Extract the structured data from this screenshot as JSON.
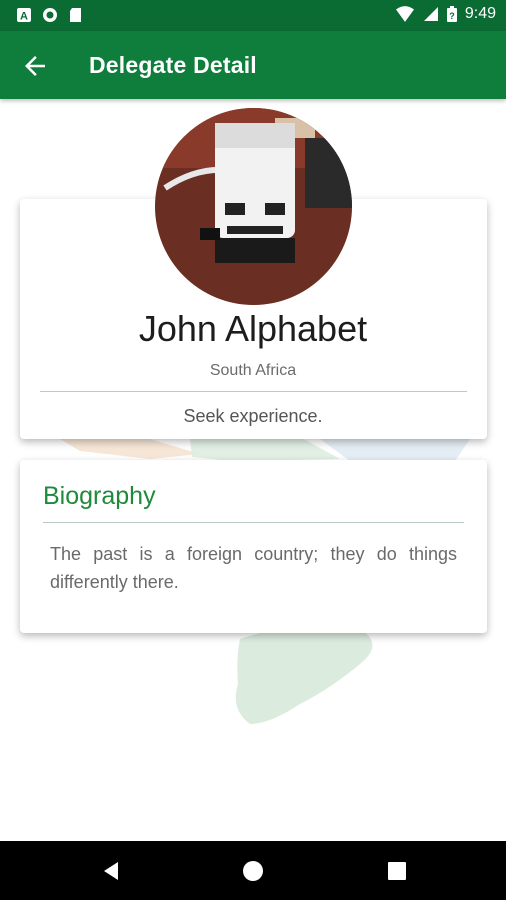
{
  "status_bar": {
    "time": "9:49",
    "icons": [
      "a-notification-icon",
      "record-icon",
      "sd-card-icon",
      "wifi-icon",
      "signal-icon",
      "battery-icon"
    ]
  },
  "app_bar": {
    "title": "Delegate Detail",
    "back_icon": "arrow-back-icon",
    "color": "#0f7d3c"
  },
  "profile": {
    "name": "John Alphabet",
    "country": "South Africa",
    "tagline": "Seek experience."
  },
  "biography": {
    "heading": "Biography",
    "text": "The past is a foreign country; they do things differently there.",
    "heading_color": "#1f8a3c"
  },
  "nav_bar": {
    "icons": [
      "back-triangle-icon",
      "home-circle-icon",
      "recents-square-icon"
    ]
  }
}
